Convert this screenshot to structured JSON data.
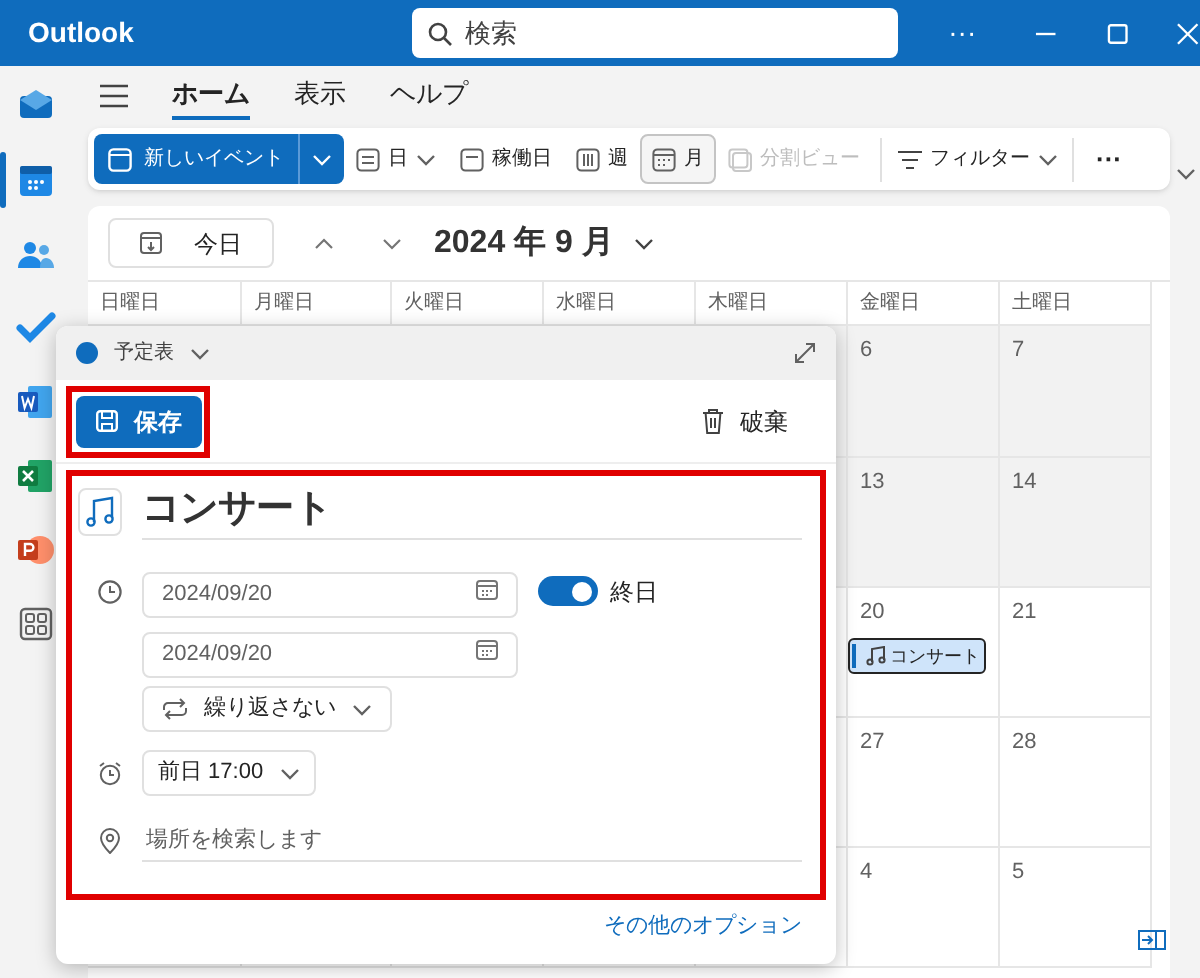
{
  "window": {
    "title": "Outlook",
    "search_placeholder": "検索",
    "more": "···"
  },
  "rail": [
    {
      "kind": "mail",
      "selected": false
    },
    {
      "kind": "calendar",
      "selected": true
    },
    {
      "kind": "people",
      "selected": false
    },
    {
      "kind": "todo",
      "selected": false
    },
    {
      "kind": "word",
      "selected": false
    },
    {
      "kind": "excel",
      "selected": false
    },
    {
      "kind": "powerpoint",
      "selected": false
    },
    {
      "kind": "apps",
      "selected": false
    }
  ],
  "nav_tabs": [
    {
      "label": "ホーム",
      "selected": true
    },
    {
      "label": "表示",
      "selected": false
    },
    {
      "label": "ヘルプ",
      "selected": false
    }
  ],
  "toolbar": {
    "new_event": "新しいイベント",
    "views": [
      {
        "kind": "day",
        "label": "日",
        "selected": false,
        "disabled": false
      },
      {
        "kind": "workweek",
        "label": "稼働日",
        "selected": false,
        "disabled": false
      },
      {
        "kind": "week",
        "label": "週",
        "selected": false,
        "disabled": false
      },
      {
        "kind": "month",
        "label": "月",
        "selected": true,
        "disabled": false
      },
      {
        "kind": "split",
        "label": "分割ビュー",
        "selected": false,
        "disabled": true
      }
    ],
    "filter": "フィルター",
    "more": "···"
  },
  "calendar_header": {
    "today": "今日",
    "month": "2024 年 9 月"
  },
  "weekdays": [
    "日曜日",
    "月曜日",
    "火曜日",
    "水曜日",
    "木曜日",
    "金曜日",
    "土曜日"
  ],
  "weeks": [
    {
      "past": true,
      "days": [
        "6",
        "7"
      ]
    },
    {
      "past": true,
      "days": [
        "13",
        "14"
      ]
    },
    {
      "past": false,
      "days": [
        "20",
        "21"
      ],
      "event": {
        "title": "コンサート"
      }
    },
    {
      "past": false,
      "days": [
        "27",
        "28"
      ]
    },
    {
      "past": false,
      "days": [
        "4",
        "5"
      ]
    }
  ],
  "popup": {
    "calendar": "予定表",
    "save": "保存",
    "discard": "破棄",
    "title": "コンサート",
    "start_date": "2024/09/20",
    "end_date": "2024/09/20",
    "all_day": {
      "label": "終日",
      "on": true
    },
    "repeat": "繰り返さない",
    "reminder": "前日 17:00",
    "location_placeholder": "場所を検索します",
    "more_options": "その他のオプション"
  }
}
